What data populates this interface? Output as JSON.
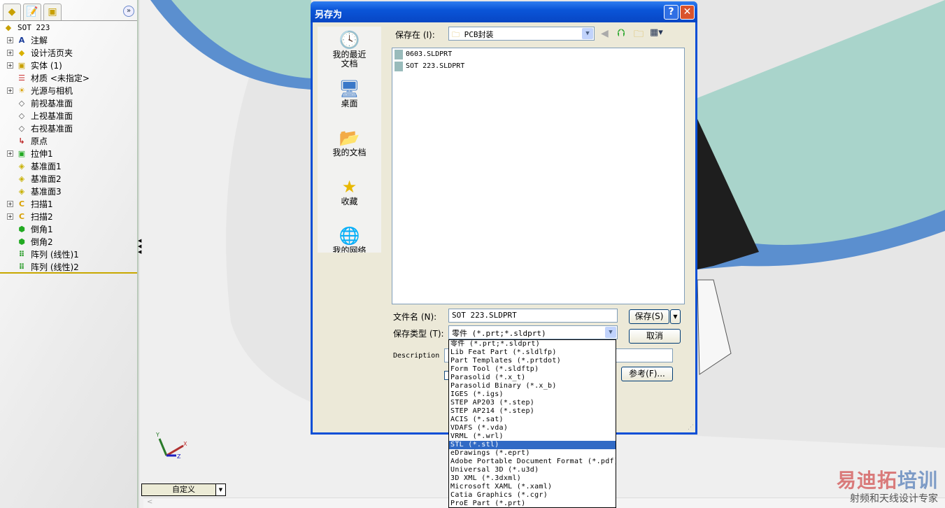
{
  "feature_tree": {
    "root": "SOT 223",
    "items": [
      {
        "label": "注解",
        "expandable": true,
        "icon": "annotations-icon"
      },
      {
        "label": "设计活页夹",
        "expandable": true,
        "icon": "design-binder-icon"
      },
      {
        "label": "实体 (1)",
        "expandable": true,
        "icon": "solid-bodies-icon"
      },
      {
        "label": "材质 <未指定>",
        "expandable": false,
        "icon": "material-icon"
      },
      {
        "label": "光源与相机",
        "expandable": true,
        "icon": "lights-cameras-icon"
      },
      {
        "label": "前视基准面",
        "expandable": false,
        "icon": "plane-icon"
      },
      {
        "label": "上视基准面",
        "expandable": false,
        "icon": "plane-icon"
      },
      {
        "label": "右视基准面",
        "expandable": false,
        "icon": "plane-icon"
      },
      {
        "label": "原点",
        "expandable": false,
        "icon": "origin-icon"
      },
      {
        "label": "拉伸1",
        "expandable": true,
        "icon": "extrude-icon"
      },
      {
        "label": "基准面1",
        "expandable": false,
        "icon": "ref-plane-icon"
      },
      {
        "label": "基准面2",
        "expandable": false,
        "icon": "ref-plane-icon"
      },
      {
        "label": "基准面3",
        "expandable": false,
        "icon": "ref-plane-icon"
      },
      {
        "label": "扫描1",
        "expandable": true,
        "icon": "sweep-icon"
      },
      {
        "label": "扫描2",
        "expandable": true,
        "icon": "sweep-icon"
      },
      {
        "label": "倒角1",
        "expandable": false,
        "icon": "chamfer-icon"
      },
      {
        "label": "倒角2",
        "expandable": false,
        "icon": "chamfer-icon"
      },
      {
        "label": "阵列 (线性)1",
        "expandable": false,
        "icon": "linear-pattern-icon"
      },
      {
        "label": "阵列 (线性)2",
        "expandable": false,
        "icon": "linear-pattern-icon"
      }
    ]
  },
  "dialog": {
    "title": "另存为",
    "help": "?",
    "close": "✕",
    "save_in_label": "保存在 (I):",
    "save_in_value": "PCB封装",
    "places": [
      {
        "label": "我的最近文档",
        "icon": "recent-docs-icon",
        "glyph": "🕓"
      },
      {
        "label": "桌面",
        "icon": "desktop-icon",
        "glyph": "🖥"
      },
      {
        "label": "我的文档",
        "icon": "my-documents-icon",
        "glyph": "📂"
      },
      {
        "label": "收藏",
        "icon": "favorites-icon",
        "glyph": "★"
      },
      {
        "label": "我的网络",
        "icon": "network-icon",
        "glyph": "🌐"
      }
    ],
    "files": [
      "0603.SLDPRT",
      "SOT 223.SLDPRT"
    ],
    "filename_label": "文件名 (N):",
    "filename_value": "SOT 223.SLDPRT",
    "filetype_label": "保存类型 (T):",
    "filetype_value": "零件 (*.prt;*.sldprt)",
    "description_label": "Description",
    "save_button": "保存(S)",
    "cancel_button": "取消",
    "references_button": "参考(F)...",
    "filetype_options": [
      "零件 (*.prt;*.sldprt)",
      "Lib Feat Part (*.sldlfp)",
      "Part Templates (*.prtdot)",
      "Form Tool (*.sldftp)",
      "Parasolid (*.x_t)",
      "Parasolid Binary (*.x_b)",
      "IGES (*.igs)",
      "STEP AP203 (*.step)",
      "STEP AP214 (*.step)",
      "ACIS (*.sat)",
      "VDAFS (*.vda)",
      "VRML (*.wrl)",
      "STL (*.stl)",
      "eDrawings (*.eprt)",
      "Adobe Portable Document Format (*.pdf)",
      "Universal 3D (*.u3d)",
      "3D XML (*.3dxml)",
      "Microsoft XAML (*.xaml)",
      "Catia Graphics (*.cgr)",
      "ProE Part (*.prt)"
    ],
    "highlighted_option": "STL (*.stl)"
  },
  "viewport": {
    "view_orientation": "自定义",
    "triad": {
      "x": "X",
      "y": "Y",
      "z": "Z"
    }
  },
  "watermark": {
    "title": "易迪拓培训",
    "subtitle": "射频和天线设计专家"
  }
}
